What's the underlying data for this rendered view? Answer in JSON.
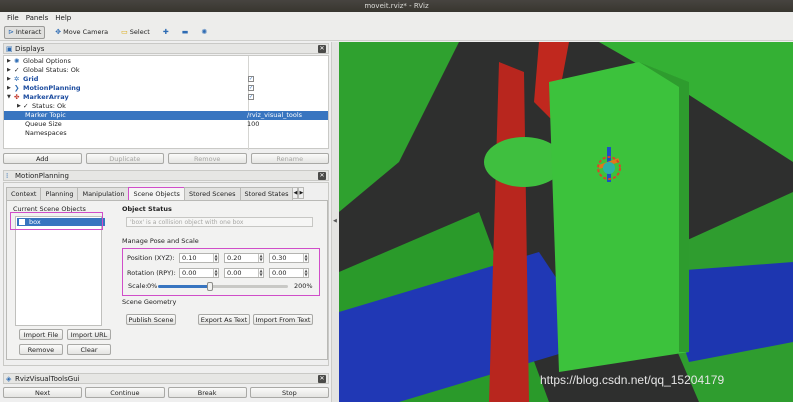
{
  "window": {
    "title": "moveit.rviz* - RViz"
  },
  "menu": {
    "file": "File",
    "panels": "Panels",
    "help": "Help"
  },
  "toolbar": {
    "interact": "Interact",
    "move_camera": "Move Camera",
    "select": "Select"
  },
  "displays": {
    "title": "Displays",
    "items": {
      "global_options": "Global Options",
      "global_status": "Global Status: Ok",
      "grid": "Grid",
      "motion_planning": "MotionPlanning",
      "marker_array": "MarkerArray",
      "status_ok": "Status: Ok",
      "marker_topic": "Marker Topic",
      "marker_topic_value": "/rviz_visual_tools",
      "queue_size": "Queue Size",
      "queue_size_value": "100",
      "namespaces": "Namespaces"
    },
    "buttons": {
      "add": "Add",
      "duplicate": "Duplicate",
      "remove": "Remove",
      "rename": "Rename"
    }
  },
  "motion_planning": {
    "title": "MotionPlanning",
    "tabs": [
      "Context",
      "Planning",
      "Manipulation",
      "Scene Objects",
      "Stored Scenes",
      "Stored States"
    ],
    "scene_objects": {
      "current_label": "Current Scene Objects",
      "object_name": "box",
      "object_status_label": "Object Status",
      "object_status_value": "'box' is a collision object with one box",
      "manage_label": "Manage Pose and Scale",
      "position_label": "Position (XYZ):",
      "position": [
        "0.10",
        "0.20",
        "0.30"
      ],
      "rotation_label": "Rotation (RPY):",
      "rotation": [
        "0.00",
        "0.00",
        "0.00"
      ],
      "scale_label": "Scale:",
      "scale_min": "0%",
      "scale_max": "200%",
      "scale_value": 0.4,
      "geometry_label": "Scene Geometry",
      "publish_scene": "Publish Scene",
      "export_as_text": "Export As Text",
      "import_from_text": "Import From Text",
      "import_file": "Import File",
      "import_url": "Import URL",
      "remove": "Remove",
      "clear": "Clear"
    }
  },
  "rviz_visual_tools": {
    "title": "RvizVisualToolsGui",
    "buttons": {
      "next": "Next",
      "continue": "Continue",
      "break": "Break",
      "stop": "Stop"
    }
  },
  "watermark": "https://blog.csdn.net/qq_15204179",
  "colors": {
    "selection": "#3875c0",
    "highlight": "#d04ec9",
    "scene_green": "#33b533",
    "scene_red": "#c7261e",
    "scene_blue": "#1f3fc4"
  }
}
